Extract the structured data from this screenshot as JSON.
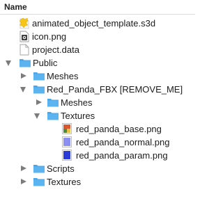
{
  "header": {
    "column_name": "Name"
  },
  "rows": [
    {
      "label": "animated_object_template.s3d",
      "icon": "s3d-file-icon"
    },
    {
      "label": "icon.png",
      "icon": "png-file-icon"
    },
    {
      "label": "project.data",
      "icon": "document-file-icon"
    },
    {
      "label": "Public",
      "icon": "folder-icon",
      "expanded": true
    },
    {
      "label": "Meshes",
      "icon": "folder-icon",
      "expanded": false
    },
    {
      "label": "Red_Panda_FBX [REMOVE_ME]",
      "icon": "folder-icon",
      "expanded": true
    },
    {
      "label": "Meshes",
      "icon": "folder-icon",
      "expanded": false
    },
    {
      "label": "Textures",
      "icon": "folder-icon",
      "expanded": true
    },
    {
      "label": "red_panda_base.png",
      "icon": "image-file-icon"
    },
    {
      "label": "red_panda_normal.png",
      "icon": "image-file-icon"
    },
    {
      "label": "red_panda_param.png",
      "icon": "image-file-icon"
    },
    {
      "label": "Scripts",
      "icon": "folder-icon",
      "expanded": false
    },
    {
      "label": "Textures",
      "icon": "folder-icon",
      "expanded": false
    }
  ],
  "colors": {
    "folder": "#5bb3f0",
    "folder_tab": "#4aa6e8",
    "disclosure": "#7c7c7c",
    "base_texture": "#d9572e",
    "normal_texture": "#8b8ff0",
    "param_texture": "#2b3bd6",
    "s3d_icon": "#f5c518"
  }
}
